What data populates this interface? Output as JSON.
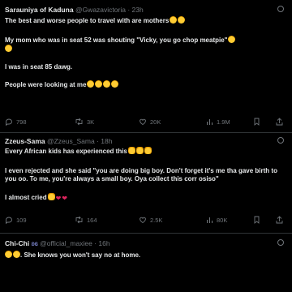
{
  "posts": [
    {
      "name": "Sarauniya of Kaduna",
      "handle": "@Gwazavictoria",
      "time": "23h",
      "paragraphs": [
        "The best and worse people to travel with are mothers",
        "My mom who was in seat 52 was shouting \"Vicky, you go chop meatpie\"",
        "I was in seat 85 dawg.",
        "People were looking at me"
      ],
      "actions": {
        "replies": "798",
        "reposts": "3K",
        "likes": "20K",
        "views": "1.9M"
      }
    },
    {
      "name": "Zzeus-Sama",
      "handle": "@Zzeus_Sama",
      "time": "18h",
      "paragraphs": [
        "Every African kids has experienced this",
        "I even rejected and she said \"you are doing big boy. Don't forget it's me tha gave birth to you oo. To me, you're always a small boy. Oya collect this corr osiso\"",
        "I almost cried"
      ],
      "actions": {
        "replies": "109",
        "reposts": "164",
        "likes": "2.5K",
        "views": "80K"
      }
    },
    {
      "name": "Chi-Chi",
      "handle": "@official_maxiee",
      "time": "16h",
      "paragraphs": [
        ". She knows you won't say no at home."
      ]
    }
  ],
  "colors": {
    "background": "#000000",
    "text": "#e7e9ea",
    "muted": "#71767b",
    "divider": "#2f3336",
    "heart_red": "#e0245e"
  },
  "icons": [
    "more-icon",
    "reply-icon",
    "repost-icon",
    "like-icon",
    "views-icon",
    "bookmark-icon",
    "share-icon"
  ]
}
